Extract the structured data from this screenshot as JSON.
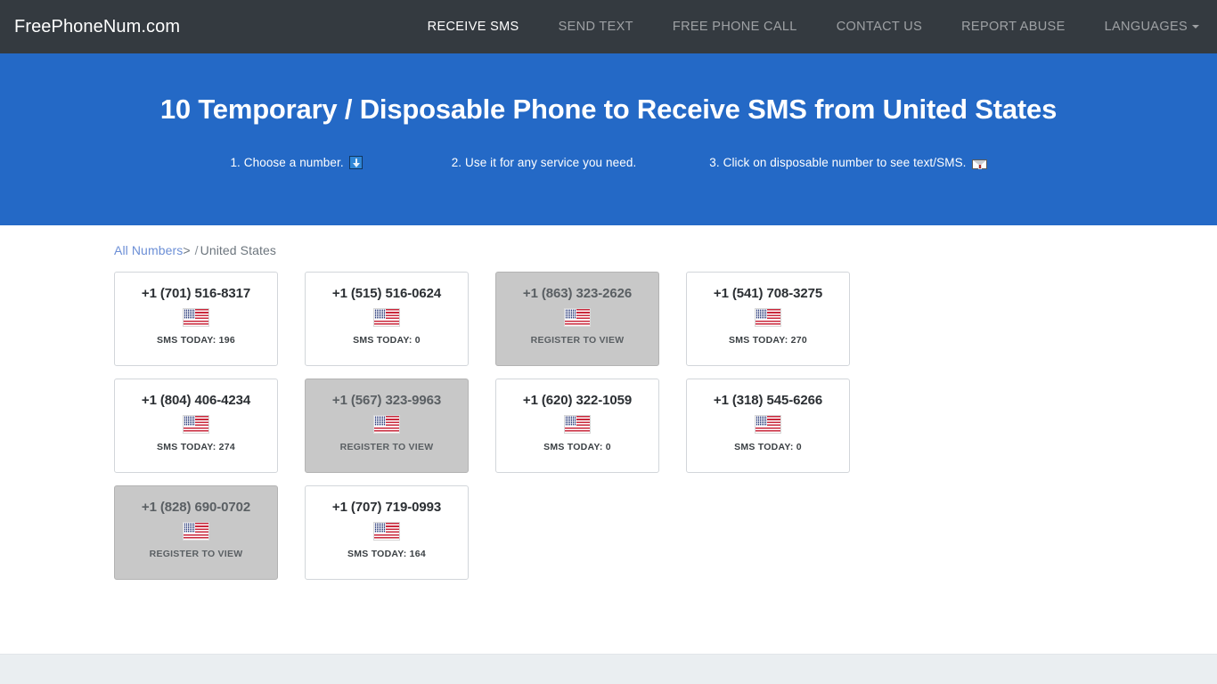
{
  "site": {
    "brand": "FreePhoneNum.com",
    "accent_blue": "#2469c6",
    "navbar_dark": "#343a40",
    "locked_gray": "#c8c8c8"
  },
  "nav": {
    "items": [
      {
        "label": "RECEIVE SMS",
        "active": true
      },
      {
        "label": "SEND TEXT",
        "active": false
      },
      {
        "label": "FREE PHONE CALL",
        "active": false
      },
      {
        "label": "CONTACT US",
        "active": false
      },
      {
        "label": "REPORT ABUSE",
        "active": false
      },
      {
        "label": "LANGUAGES",
        "active": false,
        "icon": "chevron-down-icon"
      }
    ]
  },
  "hero": {
    "title": "10 Temporary / Disposable Phone to Receive SMS from United States",
    "steps": [
      {
        "text": "1. Choose a number.",
        "icon": "arrow-down-icon"
      },
      {
        "text": "2. Use it for any service you need.",
        "icon": ""
      },
      {
        "text": "3. Click on disposable number to see text/SMS.",
        "icon": "mailbox-icon"
      }
    ]
  },
  "breadcrumb": {
    "root_label": "All Numbers",
    "arrow": ">",
    "separator": "/",
    "current": "United States"
  },
  "numbers": [
    {
      "number": "+1 (701) 516-8317",
      "flag": "us-flag-icon",
      "status": "SMS TODAY: 196",
      "locked": false
    },
    {
      "number": "+1 (515) 516-0624",
      "flag": "us-flag-icon",
      "status": "SMS TODAY: 0",
      "locked": false
    },
    {
      "number": "+1 (863) 323-2626",
      "flag": "us-flag-icon",
      "status": "REGISTER TO VIEW",
      "locked": true
    },
    {
      "number": "+1 (541) 708-3275",
      "flag": "us-flag-icon",
      "status": "SMS TODAY: 270",
      "locked": false
    },
    {
      "number": "+1 (804) 406-4234",
      "flag": "us-flag-icon",
      "status": "SMS TODAY: 274",
      "locked": false
    },
    {
      "number": "+1 (567) 323-9963",
      "flag": "us-flag-icon",
      "status": "REGISTER TO VIEW",
      "locked": true
    },
    {
      "number": "+1 (620) 322-1059",
      "flag": "us-flag-icon",
      "status": "SMS TODAY: 0",
      "locked": false
    },
    {
      "number": "+1 (318) 545-6266",
      "flag": "us-flag-icon",
      "status": "SMS TODAY: 0",
      "locked": false
    },
    {
      "number": "+1 (828) 690-0702",
      "flag": "us-flag-icon",
      "status": "REGISTER TO VIEW",
      "locked": true
    },
    {
      "number": "+1 (707) 719-0993",
      "flag": "us-flag-icon",
      "status": "SMS TODAY: 164",
      "locked": false
    }
  ]
}
